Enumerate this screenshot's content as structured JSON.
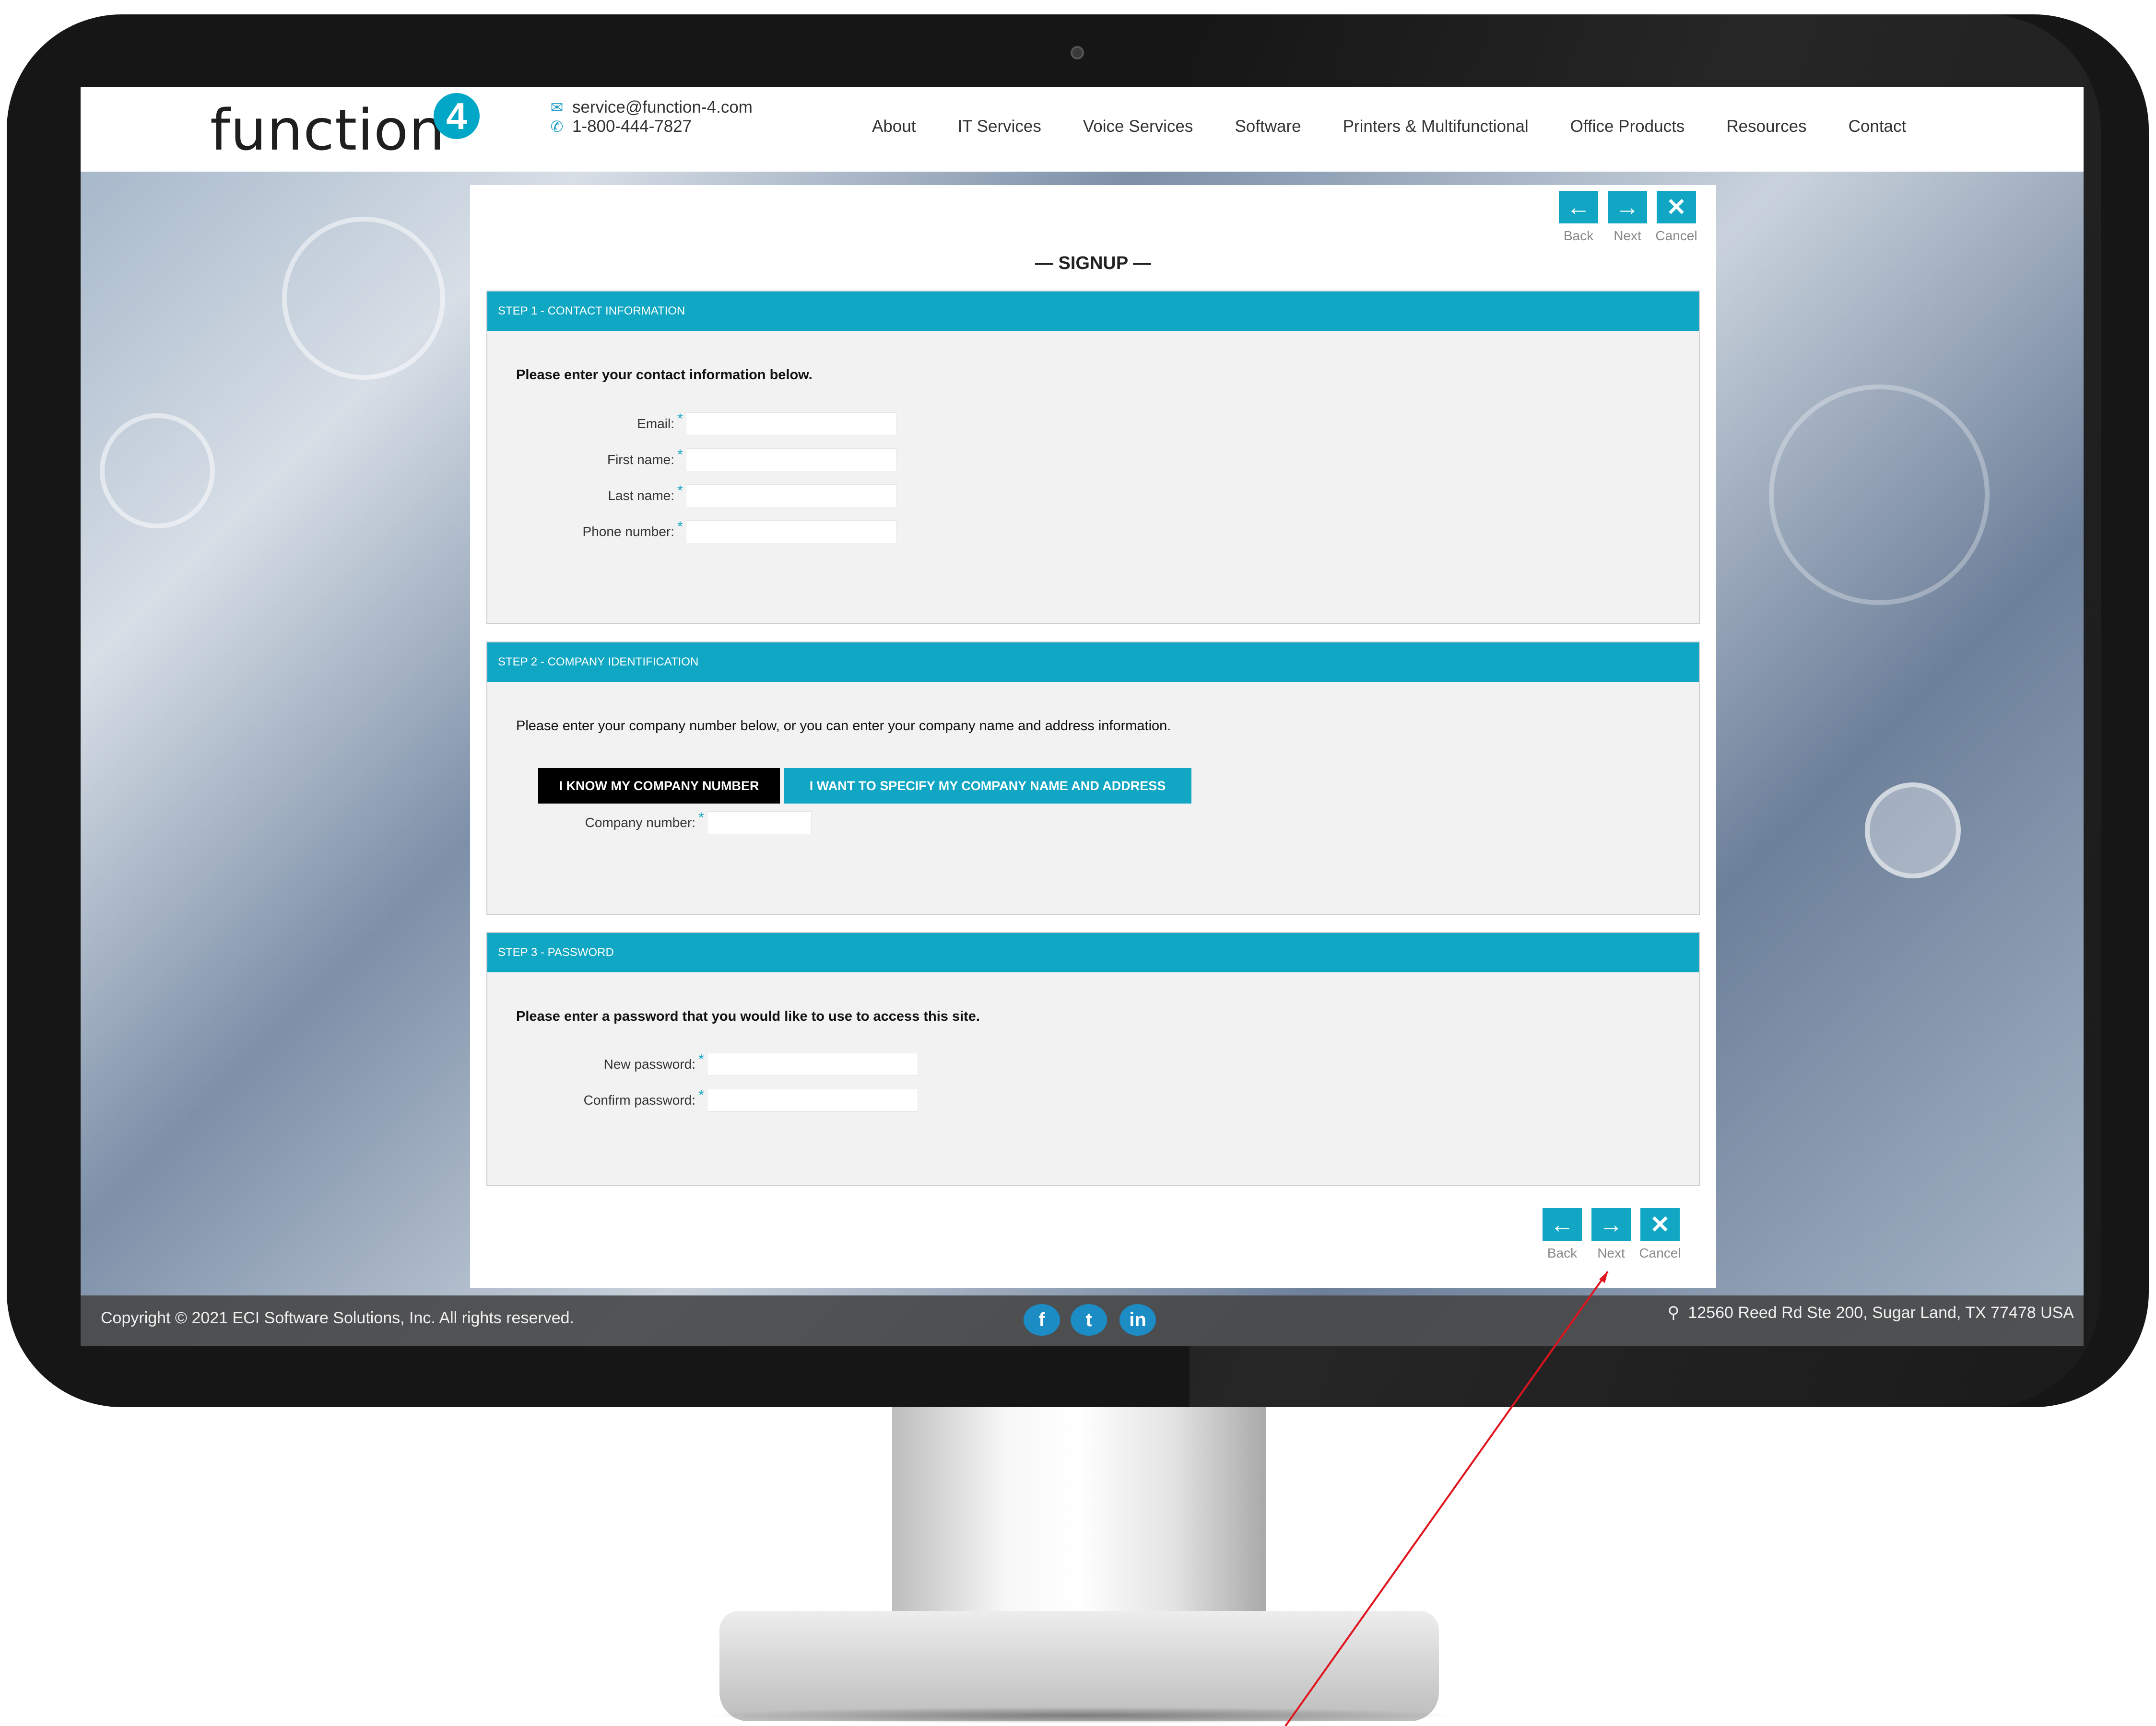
{
  "header": {
    "logo_text": "function",
    "logo_badge": "4",
    "email": "service@function-4.com",
    "phone": "1-800-444-7827",
    "nav": [
      "About",
      "IT Services",
      "Voice Services",
      "Software",
      "Printers & Multifunctional",
      "Office Products",
      "Resources",
      "Contact"
    ]
  },
  "toolbar": {
    "back_label": "Back",
    "next_label": "Next",
    "cancel_label": "Cancel",
    "back_icon": "arrow-left-icon",
    "next_icon": "arrow-right-icon",
    "cancel_icon": "close-icon"
  },
  "form": {
    "title": "— SIGNUP —",
    "step1": {
      "header": "STEP 1 - CONTACT INFORMATION",
      "intro": "Please enter your contact information below.",
      "fields": [
        {
          "label": "Email:",
          "value": ""
        },
        {
          "label": "First name:",
          "value": ""
        },
        {
          "label": "Last name:",
          "value": ""
        },
        {
          "label": "Phone number:",
          "value": ""
        }
      ]
    },
    "step2": {
      "header": "STEP 2 - COMPANY IDENTIFICATION",
      "intro": "Please enter your company number below, or you can enter your company name and address information.",
      "option_known": "I KNOW MY COMPANY NUMBER",
      "option_specify": "I WANT TO SPECIFY MY COMPANY NAME AND ADDRESS",
      "company_number_label": "Company number:",
      "company_number_value": ""
    },
    "step3": {
      "header": "STEP 3 - PASSWORD",
      "intro": "Please enter a password that you would like to use to access this site.",
      "new_password_label": "New password:",
      "confirm_password_label": "Confirm password:"
    },
    "required_mark": "*"
  },
  "footer": {
    "copyright": "Copyright © 2021 ECI Software Solutions, Inc. All rights reserved.",
    "social": [
      "f",
      "t",
      "in"
    ],
    "address": "12560 Reed Rd Ste 200, Sugar Land, TX 77478 USA"
  },
  "colors": {
    "accent": "#11a7c4",
    "selected_option": "#000000",
    "footer_bg": "#464646",
    "annotation": "#e0141e"
  }
}
